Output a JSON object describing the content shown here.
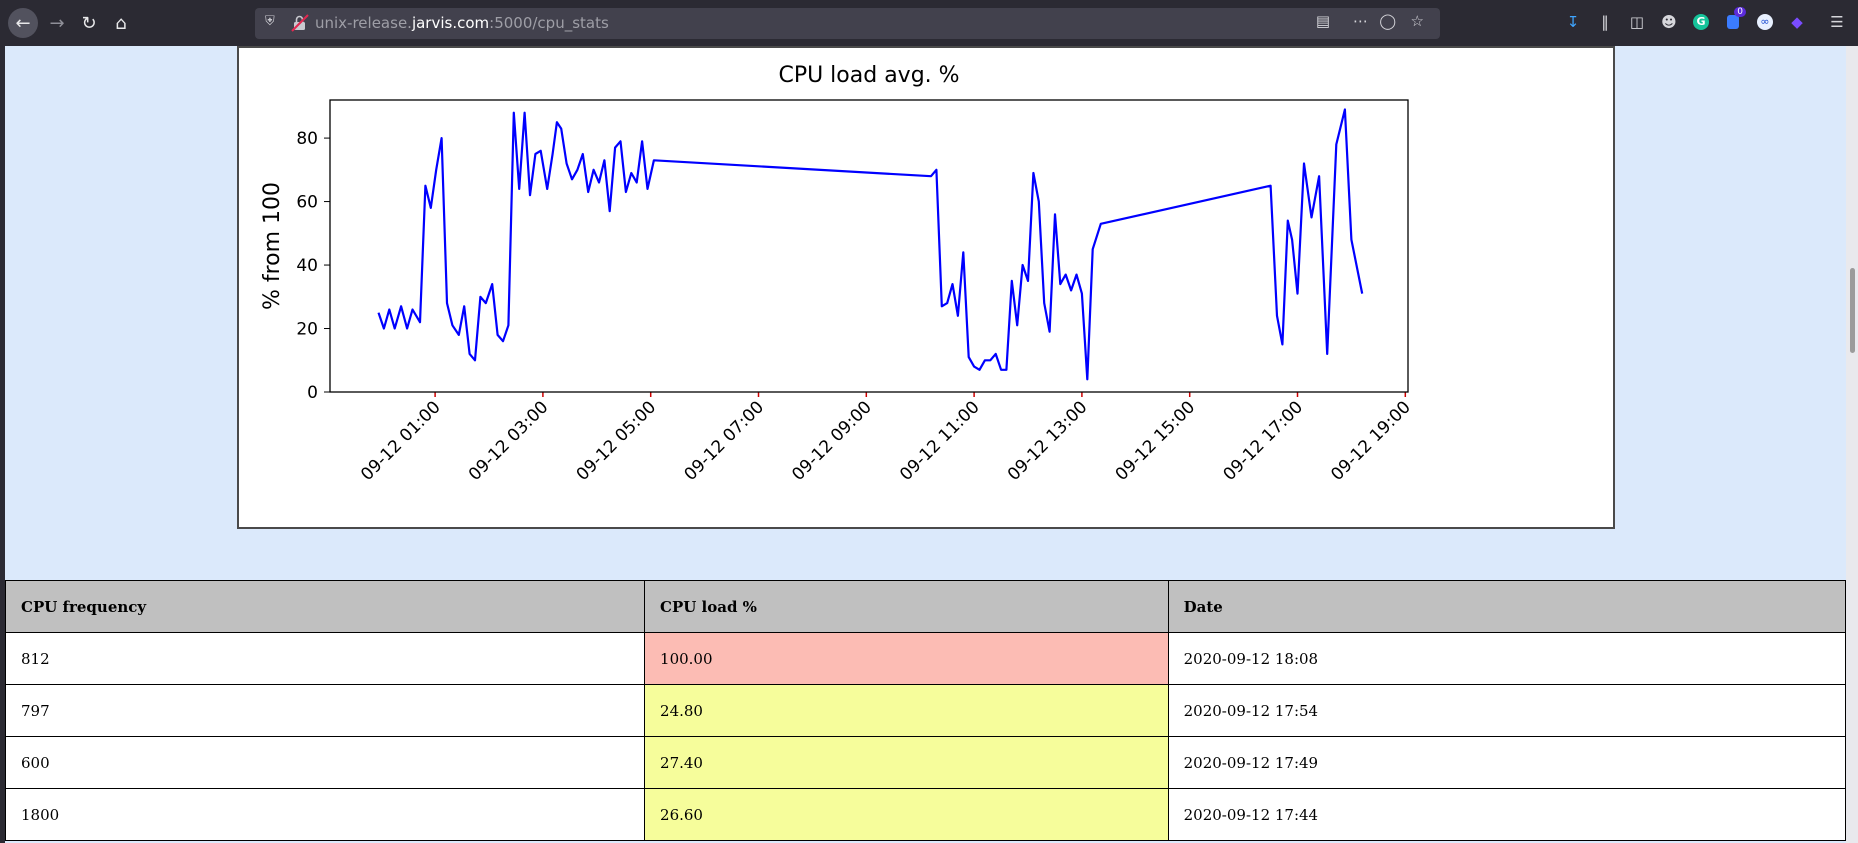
{
  "browser": {
    "url_host_prefix": "unix-release.",
    "url_host": "jarvis.com",
    "url_rest": ":5000/cpu_stats",
    "notification_badge": "0"
  },
  "chart_data": {
    "type": "line",
    "title": "CPU load avg. %",
    "ylabel": "% from 100",
    "xlabel": "",
    "ylim": [
      0,
      92
    ],
    "yticks": [
      0,
      20,
      40,
      60,
      80
    ],
    "xlim": [
      -0.95,
      19.05
    ],
    "xtick_positions": [
      1,
      3,
      5,
      7,
      9,
      11,
      13,
      15,
      17,
      19
    ],
    "xtick_labels": [
      "09-12 01:00",
      "09-12 03:00",
      "09-12 05:00",
      "09-12 07:00",
      "09-12 09:00",
      "09-12 11:00",
      "09-12 13:00",
      "09-12 15:00",
      "09-12 17:00",
      "09-12 19:00"
    ],
    "series": [
      {
        "color": "#0000ff",
        "x": [
          -0.05,
          0.05,
          0.15,
          0.25,
          0.37,
          0.48,
          0.58,
          0.72,
          0.82,
          0.92,
          1.02,
          1.12,
          1.22,
          1.32,
          1.44,
          1.54,
          1.64,
          1.74,
          1.84,
          1.94,
          2.06,
          2.16,
          2.26,
          2.36,
          2.46,
          2.56,
          2.66,
          2.76,
          2.86,
          2.96,
          3.08,
          3.18,
          3.26,
          3.34,
          3.44,
          3.54,
          3.64,
          3.74,
          3.84,
          3.94,
          4.04,
          4.14,
          4.24,
          4.34,
          4.44,
          4.54,
          4.64,
          4.74,
          4.84,
          4.94,
          5.06,
          10.2,
          10.3,
          10.4,
          10.5,
          10.6,
          10.7,
          10.8,
          10.9,
          11.0,
          11.1,
          11.2,
          11.3,
          11.4,
          11.5,
          11.6,
          11.7,
          11.8,
          11.9,
          12.0,
          12.1,
          12.2,
          12.3,
          12.4,
          12.5,
          12.6,
          12.7,
          12.8,
          12.9,
          13.0,
          13.1,
          13.2,
          13.35,
          16.5,
          16.62,
          16.72,
          16.82,
          16.9,
          17.0,
          17.12,
          17.26,
          17.4,
          17.55,
          17.72,
          17.88,
          18.0,
          18.2
        ],
        "y": [
          25,
          20,
          26,
          20,
          27,
          20,
          26,
          22,
          65,
          58,
          70,
          80,
          28,
          21,
          18,
          27,
          12,
          10,
          30,
          28,
          34,
          18,
          16,
          21,
          88,
          64,
          88,
          62,
          75,
          76,
          64,
          75,
          85,
          83,
          72,
          67,
          70,
          75,
          63,
          70,
          66,
          73,
          57,
          77,
          79,
          63,
          69,
          66,
          79,
          64,
          73,
          68,
          70,
          27,
          28,
          34,
          24,
          44,
          11,
          8,
          7,
          10,
          10,
          12,
          7,
          7,
          35,
          21,
          40,
          35,
          69,
          60,
          28,
          19,
          56,
          34,
          37,
          32,
          37,
          31,
          4,
          45,
          53,
          65,
          24,
          15,
          54,
          48,
          31,
          72,
          55,
          68,
          12,
          78,
          89,
          48,
          31
        ]
      }
    ]
  },
  "table": {
    "headers": [
      "CPU frequency",
      "CPU load %",
      "Date"
    ],
    "rows": [
      [
        "812",
        "100.00",
        "2020-09-12 18:08"
      ],
      [
        "797",
        "24.80",
        "2020-09-12 17:54"
      ],
      [
        "600",
        "27.40",
        "2020-09-12 17:49"
      ],
      [
        "1800",
        "26.60",
        "2020-09-12 17:44"
      ]
    ],
    "load_colors": {
      "high": "#fcbcb4",
      "normal": "#f6fd9b"
    }
  }
}
